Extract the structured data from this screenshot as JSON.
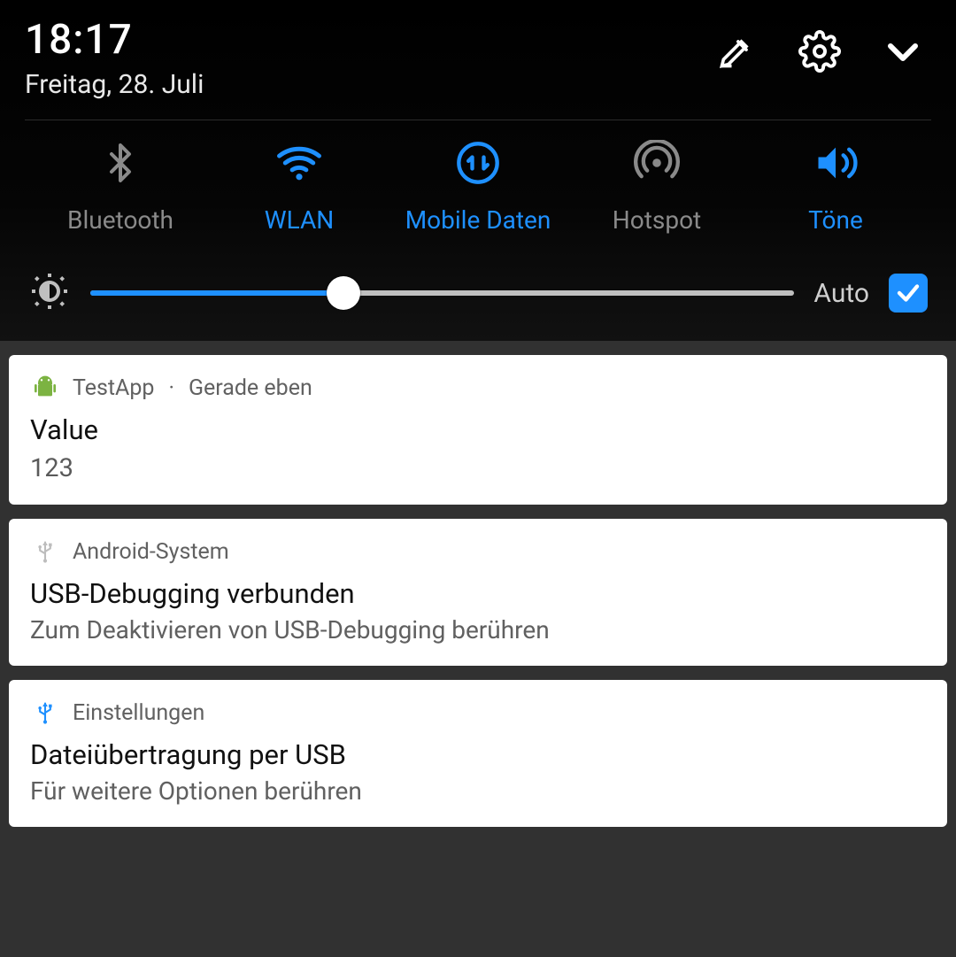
{
  "status": {
    "time": "18:17",
    "date": "Freitag, 28. Juli"
  },
  "quick_settings": [
    {
      "id": "bluetooth",
      "label": "Bluetooth",
      "active": false
    },
    {
      "id": "wlan",
      "label": "WLAN",
      "active": true
    },
    {
      "id": "mobile-data",
      "label": "Mobile Daten",
      "active": true
    },
    {
      "id": "hotspot",
      "label": "Hotspot",
      "active": false
    },
    {
      "id": "sound",
      "label": "Töne",
      "active": true
    }
  ],
  "brightness": {
    "percent": 36,
    "auto_label": "Auto",
    "auto_checked": true
  },
  "notifications": [
    {
      "app": "TestApp",
      "time_label": "Gerade eben",
      "title": "Value",
      "body": "123",
      "icon": "android"
    },
    {
      "app": "Android-System",
      "title": "USB-Debugging verbunden",
      "body": "Zum Deaktivieren von USB-Debugging berühren",
      "icon": "usb-gray"
    },
    {
      "app": "Einstellungen",
      "title": "Dateiübertragung per USB",
      "body": "Für weitere Optionen berühren",
      "icon": "usb-blue"
    }
  ],
  "colors": {
    "accent": "#1e90ff",
    "muted": "#8a8a8a"
  }
}
